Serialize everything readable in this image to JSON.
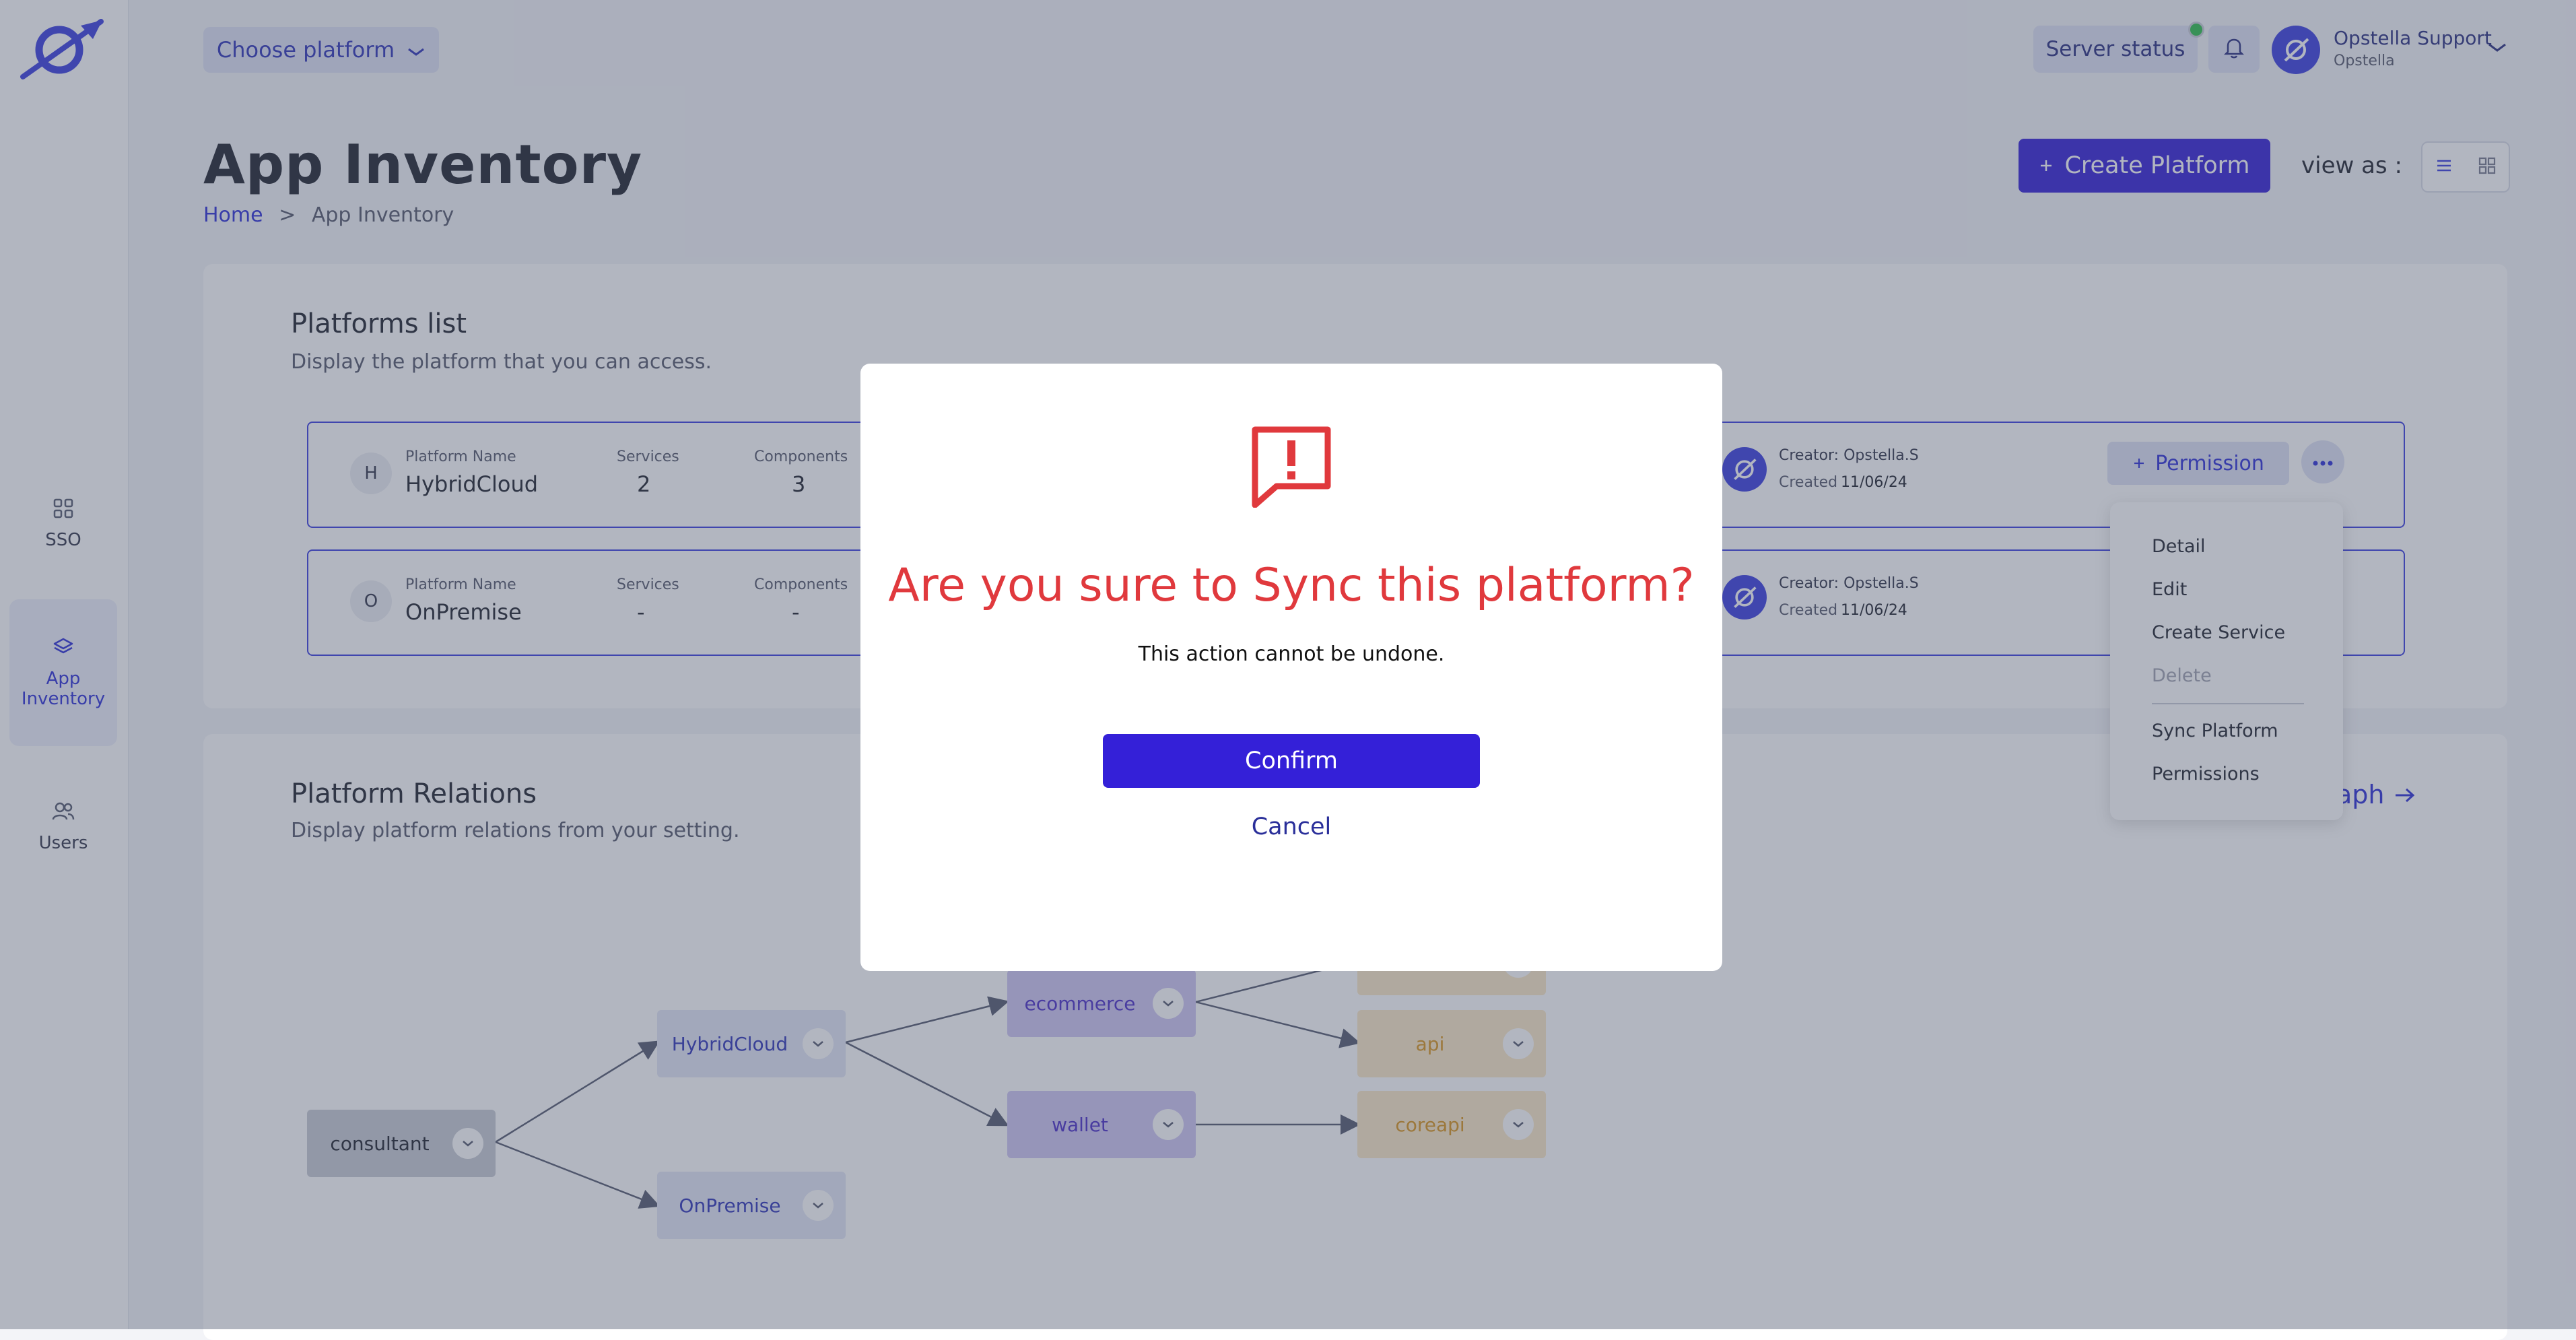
{
  "header": {
    "choose_platform": "Choose platform",
    "server_status": "Server status",
    "user_name": "Opstella Support",
    "user_org": "Opstella"
  },
  "sidebar": {
    "items": [
      {
        "label": "SSO"
      },
      {
        "label": "App\nInventory"
      },
      {
        "label": "Users"
      }
    ]
  },
  "page": {
    "title": "App Inventory",
    "breadcrumb_home": "Home",
    "breadcrumb_sep": ">",
    "breadcrumb_current": "App Inventory",
    "create_button": "Create Platform",
    "view_as": "view as :"
  },
  "platforms": {
    "title": "Platforms list",
    "description": "Display the platform that you can access.",
    "label_name": "Platform Name",
    "label_services": "Services",
    "label_components": "Components",
    "rows": [
      {
        "letter": "H",
        "name": "HybridCloud",
        "services": "2",
        "components": "3",
        "creator": "Creator: Opstella.S",
        "created_label": "Created",
        "created": "11/06/24"
      },
      {
        "letter": "O",
        "name": "OnPremise",
        "services": "-",
        "components": "-",
        "creator": "Creator: Opstella.S",
        "created_label": "Created",
        "created": "11/06/24"
      }
    ],
    "permission_button": "Permission"
  },
  "menu": {
    "items": [
      "Detail",
      "Edit",
      "Create Service",
      "Delete",
      "Sync Platform",
      "Permissions"
    ]
  },
  "relations": {
    "title": "Platform Relations",
    "description": "Display platform relations from your setting.",
    "graph_link": "aph",
    "nodes": {
      "consultant": "consultant",
      "hybridcloud": "HybridCloud",
      "onpremise": "OnPremise",
      "ecommerce": "ecommerce",
      "wallet": "wallet",
      "api": "api",
      "coreapi": "coreapi"
    }
  },
  "modal": {
    "title": "Are you sure to Sync this platform?",
    "description": "This action cannot be undone.",
    "confirm": "Confirm",
    "cancel": "Cancel"
  },
  "colors": {
    "primary": "#3420d8",
    "danger": "#e0393d",
    "accent_blue": "#2d2fd8"
  }
}
